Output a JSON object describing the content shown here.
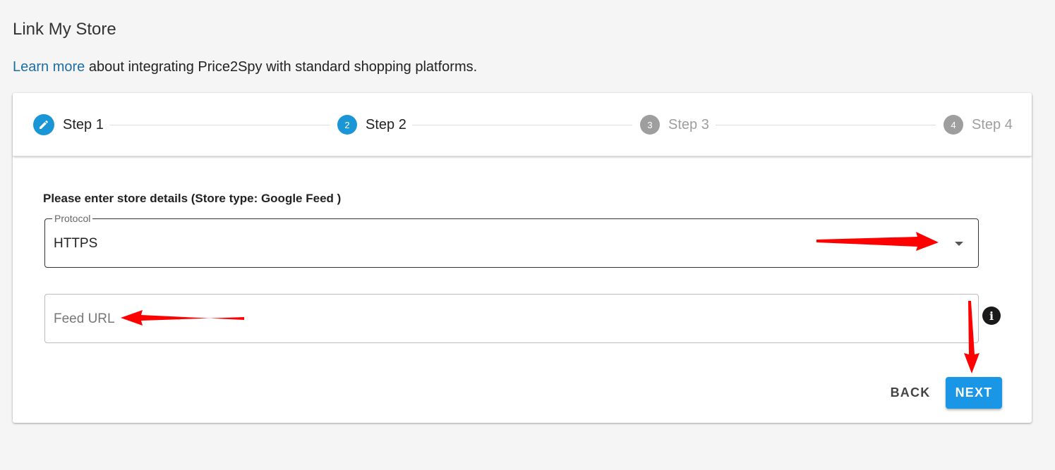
{
  "page": {
    "title": "Link My Store",
    "intro_link": "Learn more",
    "intro_text": " about integrating Price2Spy with standard shopping platforms."
  },
  "stepper": {
    "steps": [
      {
        "number": "1",
        "label": "Step 1",
        "state": "done",
        "icon": "pencil-icon"
      },
      {
        "number": "2",
        "label": "Step 2",
        "state": "active"
      },
      {
        "number": "3",
        "label": "Step 3",
        "state": "inactive"
      },
      {
        "number": "4",
        "label": "Step 4",
        "state": "inactive"
      }
    ]
  },
  "form": {
    "heading": "Please enter store details (Store type: Google Feed )",
    "protocol": {
      "label": "Protocol",
      "value": "HTTPS"
    },
    "feed_url": {
      "placeholder": "Feed URL",
      "value": ""
    },
    "info_icon": "info-icon"
  },
  "actions": {
    "back_label": "BACK",
    "next_label": "NEXT"
  },
  "colors": {
    "accent": "#1a96e6",
    "link": "#1c6ea4",
    "inactive": "#9e9e9e",
    "annotation_arrow": "#ff0000"
  }
}
